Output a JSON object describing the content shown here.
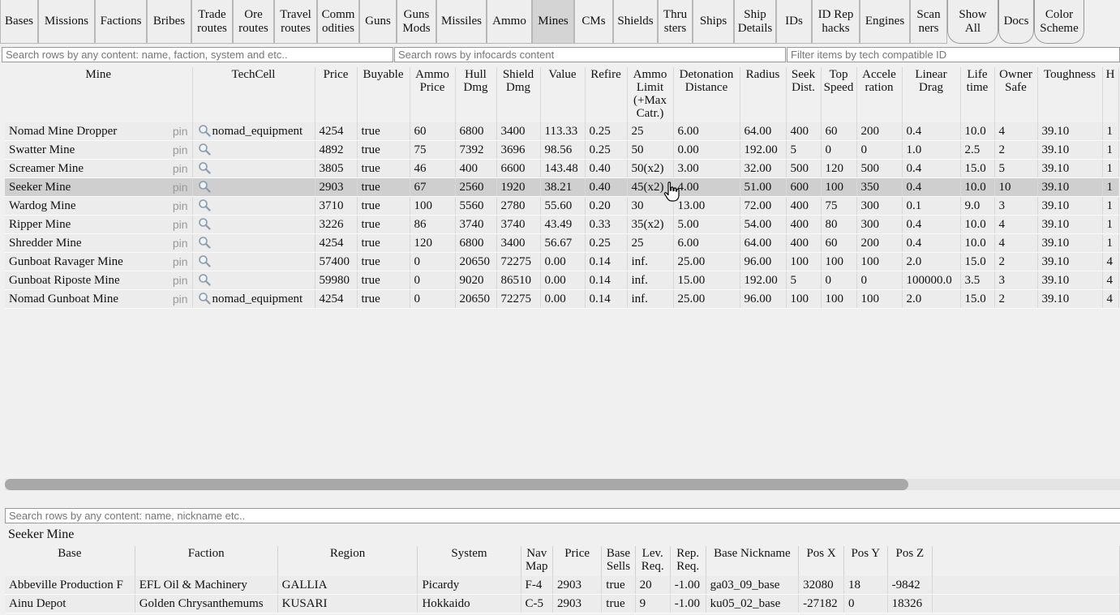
{
  "nav": [
    {
      "label": "Bases",
      "w": 47
    },
    {
      "label": "Missions",
      "w": 70
    },
    {
      "label": "Factions",
      "w": 64
    },
    {
      "label": "Bribes",
      "w": 55
    },
    {
      "label": "Trade routes",
      "w": 51
    },
    {
      "label": "Ore routes",
      "w": 51
    },
    {
      "label": "Travel routes",
      "w": 53
    },
    {
      "label": "Comm odities",
      "w": 52
    },
    {
      "label": "Guns",
      "w": 46
    },
    {
      "label": "Guns Mods",
      "w": 49
    },
    {
      "label": "Missiles",
      "w": 62
    },
    {
      "label": "Ammo",
      "w": 56
    },
    {
      "label": "Mines",
      "w": 52,
      "active": true
    },
    {
      "label": "CMs",
      "w": 48
    },
    {
      "label": "Shields",
      "w": 55
    },
    {
      "label": "Thru sters",
      "w": 43
    },
    {
      "label": "Ships",
      "w": 51
    },
    {
      "label": "Ship Details",
      "w": 52
    },
    {
      "label": "IDs",
      "w": 44
    },
    {
      "label": "ID Rep hacks",
      "w": 59
    },
    {
      "label": "Engines",
      "w": 62
    },
    {
      "label": "Scan ners",
      "w": 46
    },
    {
      "label": "Show All",
      "w": 63,
      "round": true
    },
    {
      "label": "Docs",
      "w": 44,
      "round": true
    },
    {
      "label": "Color Scheme",
      "w": 62,
      "round": true
    }
  ],
  "search": {
    "content_placeholder": "Search rows by any content: name, faction, system and etc..",
    "infocards_placeholder": "Search rows by infocards content",
    "techid_placeholder": "Filter items by tech compatible ID"
  },
  "main_table": {
    "columns": [
      {
        "label": "Mine",
        "w": 231
      },
      {
        "label": "TechCell",
        "w": 151
      },
      {
        "label": "Price",
        "w": 52
      },
      {
        "label": "Buyable",
        "w": 65
      },
      {
        "label": "Ammo Price",
        "w": 56
      },
      {
        "label": "Hull Dmg",
        "w": 51
      },
      {
        "label": "Shield Dmg",
        "w": 54
      },
      {
        "label": "Value",
        "w": 55
      },
      {
        "label": "Refire",
        "w": 52
      },
      {
        "label": "Ammo Limit (+Max Catr.)",
        "w": 57
      },
      {
        "label": "Detonation Distance",
        "w": 82
      },
      {
        "label": "Radius",
        "w": 57
      },
      {
        "label": "Seek Dist.",
        "w": 43
      },
      {
        "label": "Top Speed",
        "w": 44
      },
      {
        "label": "Accele ration",
        "w": 56
      },
      {
        "label": "Linear Drag",
        "w": 72
      },
      {
        "label": "Life time",
        "w": 42
      },
      {
        "label": "Owner Safe",
        "w": 53
      },
      {
        "label": "Toughness",
        "w": 80
      },
      {
        "label": "H",
        "w": 20
      }
    ],
    "pin_label": "pin",
    "rows": [
      [
        "Nomad Mine Dropper",
        "nomad_equipment",
        "4254",
        "true",
        "60",
        "6800",
        "3400",
        "113.33",
        "0.25",
        "25",
        "6.00",
        "64.00",
        "400",
        "60",
        "200",
        "0.4",
        "10.0",
        "4",
        "39.10",
        "1"
      ],
      [
        "Swatter Mine",
        "",
        "4892",
        "true",
        "75",
        "7392",
        "3696",
        "98.56",
        "0.25",
        "50",
        "0.00",
        "192.00",
        "5",
        "0",
        "0",
        "1.0",
        "2.5",
        "2",
        "39.10",
        "1"
      ],
      [
        "Screamer Mine",
        "",
        "3805",
        "true",
        "46",
        "400",
        "6600",
        "143.48",
        "0.40",
        "50(x2)",
        "3.00",
        "32.00",
        "500",
        "120",
        "500",
        "0.4",
        "15.0",
        "5",
        "39.10",
        "1"
      ],
      [
        "Seeker Mine",
        "",
        "2903",
        "true",
        "67",
        "2560",
        "1920",
        "38.21",
        "0.40",
        "45(x2)",
        "4.00",
        "51.00",
        "600",
        "100",
        "350",
        "0.4",
        "10.0",
        "10",
        "39.10",
        "1"
      ],
      [
        "Wardog Mine",
        "",
        "3710",
        "true",
        "100",
        "5560",
        "2780",
        "55.60",
        "0.20",
        "30",
        "13.00",
        "72.00",
        "400",
        "75",
        "300",
        "0.1",
        "9.0",
        "3",
        "39.10",
        "1"
      ],
      [
        "Ripper Mine",
        "",
        "3226",
        "true",
        "86",
        "3740",
        "3740",
        "43.49",
        "0.33",
        "35(x2)",
        "5.00",
        "54.00",
        "400",
        "80",
        "300",
        "0.4",
        "10.0",
        "4",
        "39.10",
        "1"
      ],
      [
        "Shredder Mine",
        "",
        "4254",
        "true",
        "120",
        "6800",
        "3400",
        "56.67",
        "0.25",
        "25",
        "6.00",
        "64.00",
        "400",
        "60",
        "200",
        "0.4",
        "10.0",
        "4",
        "39.10",
        "1"
      ],
      [
        "Gunboat Ravager Mine",
        "",
        "57400",
        "true",
        "0",
        "20650",
        "72275",
        "0.00",
        "0.14",
        "inf.",
        "25.00",
        "96.00",
        "100",
        "100",
        "100",
        "2.0",
        "15.0",
        "2",
        "39.10",
        "4"
      ],
      [
        "Gunboat Riposte Mine",
        "",
        "59980",
        "true",
        "0",
        "9020",
        "86510",
        "0.00",
        "0.14",
        "inf.",
        "15.00",
        "192.00",
        "5",
        "0",
        "0",
        "100000.0",
        "3.5",
        "3",
        "39.10",
        "4"
      ],
      [
        "Nomad Gunboat Mine",
        "nomad_equipment",
        "4254",
        "true",
        "0",
        "20650",
        "72275",
        "0.00",
        "0.14",
        "inf.",
        "25.00",
        "96.00",
        "100",
        "100",
        "100",
        "2.0",
        "15.0",
        "2",
        "39.10",
        "4"
      ]
    ],
    "selected_row": 3,
    "horizontal_scroll_fraction": 0.81
  },
  "details": {
    "search_placeholder": "Search rows by any content: name, nickname etc..",
    "title": "Seeker Mine",
    "columns": [
      {
        "label": "Base",
        "w": 161
      },
      {
        "label": "Faction",
        "w": 177
      },
      {
        "label": "Region",
        "w": 182
      },
      {
        "label": "System",
        "w": 132
      },
      {
        "label": "Nav Map",
        "w": 40
      },
      {
        "label": "Price",
        "w": 62
      },
      {
        "label": "Base Sells",
        "w": 42
      },
      {
        "label": "Lev. Req.",
        "w": 44
      },
      {
        "label": "Rep. Req.",
        "w": 44
      },
      {
        "label": "Base Nickname",
        "w": 116
      },
      {
        "label": "Pos X",
        "w": 56
      },
      {
        "label": "Pos Y",
        "w": 56
      },
      {
        "label": "Pos Z",
        "w": 56
      },
      {
        "label": "",
        "w": 250
      }
    ],
    "rows": [
      [
        "Abbeville Production F",
        "EFL Oil & Machinery",
        "GALLIA",
        "Picardy",
        "F-4",
        "2903",
        "true",
        "20",
        "-1.00",
        "ga03_09_base",
        "32080",
        "18",
        "-9842",
        ""
      ],
      [
        "Ainu Depot",
        "Golden Chrysanthemums",
        "KUSARI",
        "Hokkaido",
        "C-5",
        "2903",
        "true",
        "9",
        "-1.00",
        "ku05_02_base",
        "-27182",
        "0",
        "18326",
        ""
      ]
    ]
  },
  "icons": {
    "techcell": "magnifier-icon",
    "cursor": "hand-pointer-icon"
  }
}
